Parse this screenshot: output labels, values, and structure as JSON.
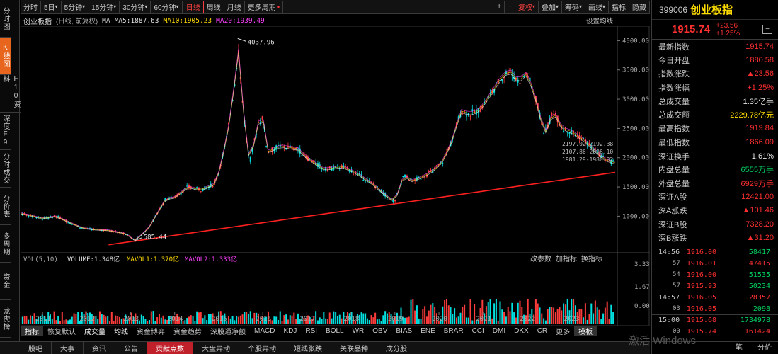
{
  "left_tabs": [
    "分时图",
    "K线图",
    "F10资料",
    "深度F9",
    "分时成交",
    "分价表",
    "多周期",
    "资金",
    "龙虎榜"
  ],
  "toolbar": {
    "items": [
      "分时",
      "5日",
      "5分钟",
      "15分钟",
      "30分钟",
      "60分钟",
      "日线",
      "周线",
      "月线",
      "更多周期"
    ],
    "active": "日线",
    "right": [
      "+",
      "−",
      "复权",
      "叠加",
      "筹码",
      "画线",
      "指标",
      "隐藏"
    ]
  },
  "chart_header": {
    "title": "创业板指",
    "period": "(日线, 前复权)",
    "ma": [
      {
        "label": "MA",
        "value": "",
        "color": "#c8c8c8"
      },
      {
        "label": "MA5:",
        "value": "1887.63",
        "color": "#e0e0e0"
      },
      {
        "label": "MA10:",
        "value": "1905.23",
        "color": "#ffdd00"
      },
      {
        "label": "MA20:",
        "value": "1939.49",
        "color": "#ff40ff"
      }
    ],
    "settings": "设置均线"
  },
  "volume_header": {
    "label": "VOL(5,10)",
    "volume": "VOLUME:1.348亿",
    "mavol1": "MAVOL1:1.370亿",
    "mavol2": "MAVOL2:1.333亿",
    "links": [
      "改参数",
      "加指标",
      "换指标"
    ]
  },
  "chart_data": {
    "type": "line",
    "price_axis": [
      4000,
      3500,
      3000,
      2500,
      2000,
      1500,
      1000
    ],
    "volume_axis": [
      "3.33",
      "1.67",
      "0.00"
    ],
    "x_years": [
      "2011",
      "2012",
      "2013",
      "2014",
      "2015",
      "2016",
      "2017",
      "2018",
      "2019",
      "2020",
      "2021",
      "2022",
      "2023"
    ],
    "annotations": {
      "high": "4037.96",
      "low": "585.44",
      "recent": [
        "2197.02-2192.38",
        "2107.86-2096.10",
        "1981.29-1980.32"
      ]
    },
    "series": [
      {
        "values": [
          [
            2010.5,
            1050
          ],
          [
            2010.8,
            1000
          ],
          [
            2011.0,
            960
          ],
          [
            2011.3,
            1000
          ],
          [
            2011.6,
            900
          ],
          [
            2011.9,
            800
          ],
          [
            2012.2,
            770
          ],
          [
            2012.5,
            760
          ],
          [
            2012.9,
            700
          ],
          [
            2013.0,
            640
          ],
          [
            2013.1,
            585
          ],
          [
            2013.4,
            790
          ],
          [
            2013.8,
            1300
          ],
          [
            2014.0,
            1320
          ],
          [
            2014.3,
            1500
          ],
          [
            2014.6,
            1450
          ],
          [
            2014.9,
            1550
          ],
          [
            2015.0,
            1750
          ],
          [
            2015.2,
            2400
          ],
          [
            2015.4,
            3500
          ],
          [
            2015.43,
            4037
          ],
          [
            2015.5,
            3300
          ],
          [
            2015.6,
            2500
          ],
          [
            2015.7,
            1900
          ],
          [
            2015.9,
            2600
          ],
          [
            2016.0,
            2700
          ],
          [
            2016.1,
            2100
          ],
          [
            2016.4,
            2200
          ],
          [
            2016.8,
            2150
          ],
          [
            2017.0,
            2000
          ],
          [
            2017.4,
            1800
          ],
          [
            2017.8,
            1850
          ],
          [
            2018.1,
            1750
          ],
          [
            2018.5,
            1550
          ],
          [
            2018.8,
            1350
          ],
          [
            2019.0,
            1250
          ],
          [
            2019.2,
            1700
          ],
          [
            2019.4,
            1600
          ],
          [
            2019.7,
            1700
          ],
          [
            2019.9,
            1800
          ],
          [
            2020.1,
            1950
          ],
          [
            2020.3,
            2300
          ],
          [
            2020.5,
            2800
          ],
          [
            2020.7,
            2750
          ],
          [
            2020.9,
            2800
          ],
          [
            2021.1,
            3000
          ],
          [
            2021.4,
            3350
          ],
          [
            2021.6,
            3500
          ],
          [
            2021.8,
            3300
          ],
          [
            2022.0,
            3450
          ],
          [
            2022.2,
            3000
          ],
          [
            2022.4,
            2400
          ],
          [
            2022.6,
            2800
          ],
          [
            2022.8,
            2500
          ],
          [
            2023.0,
            2450
          ],
          [
            2023.3,
            2300
          ],
          [
            2023.5,
            2150
          ],
          [
            2023.8,
            1950
          ],
          [
            2024.0,
            1915
          ]
        ]
      }
    ],
    "trendline": {
      "from": [
        2012.5,
        585
      ],
      "to": [
        2024.0,
        1750
      ]
    }
  },
  "indicator_tabs": [
    "指标",
    "恢复默认",
    "成交量",
    "均线",
    "资金博弈",
    "资金趋势",
    "深股通净额",
    "MACD",
    "KDJ",
    "RSI",
    "BOLL",
    "WR",
    "OBV",
    "BIAS",
    "ENE",
    "BRAR",
    "CCI",
    "DMI",
    "DKX",
    "CR",
    "更多",
    "模板"
  ],
  "bottom_nav": [
    "股吧",
    "大事",
    "资讯",
    "公告",
    "贡献点数",
    "大盘异动",
    "个股异动",
    "短线张跌",
    "关联品种",
    "成分股"
  ],
  "bottom_nav_active": "贡献点数",
  "right_panel": {
    "code": "399006",
    "name": "创业板指",
    "price": "1915.74",
    "change": "+23.56",
    "change_pct": "+1.25%",
    "mini_btn": "−",
    "rows": [
      {
        "k": "最新指数",
        "v": "1915.74",
        "c": "red"
      },
      {
        "k": "今日开盘",
        "v": "1880.58",
        "c": "red"
      },
      {
        "k": "指数涨跌",
        "v": "▲23.56",
        "c": "red"
      },
      {
        "k": "指数涨幅",
        "v": "+1.25%",
        "c": "red"
      },
      {
        "k": "总成交量",
        "v": "1.35亿手",
        "c": "wht"
      },
      {
        "k": "总成交额",
        "v": "2229.78亿元",
        "c": "yel"
      },
      {
        "k": "最高指数",
        "v": "1919.84",
        "c": "red"
      },
      {
        "k": "最低指数",
        "v": "1866.09",
        "c": "red"
      },
      {
        "k": "深证换手",
        "v": "1.61%",
        "c": "wht",
        "sep": true
      },
      {
        "k": "内盘总量",
        "v": "6555万手",
        "c": "grn"
      },
      {
        "k": "外盘总量",
        "v": "6929万手",
        "c": "red"
      },
      {
        "k": "深证A股",
        "v": "12421.00",
        "c": "red",
        "sep": true
      },
      {
        "k": "深A涨跌",
        "v": "▲101.46",
        "c": "red"
      },
      {
        "k": "深证B股",
        "v": "7328.20",
        "c": "red"
      },
      {
        "k": "深B涨跌",
        "v": "▲31.20",
        "c": "red"
      }
    ],
    "ticks": [
      {
        "t": "14:56",
        "p": "1916.00",
        "v": "58417",
        "pc": "red",
        "vc": "grn",
        "sep": true
      },
      {
        "t": "57",
        "p": "1916.01",
        "v": "47415",
        "pc": "red",
        "vc": "red",
        "s": true
      },
      {
        "t": "54",
        "p": "1916.00",
        "v": "51535",
        "pc": "red",
        "vc": "grn",
        "s": true
      },
      {
        "t": "57",
        "p": "1915.93",
        "v": "50234",
        "pc": "red",
        "vc": "grn",
        "s": true
      },
      {
        "t": "14:57",
        "p": "1916.05",
        "v": "28357",
        "pc": "red",
        "vc": "red",
        "sep": true
      },
      {
        "t": "03",
        "p": "1916.05",
        "v": "2098",
        "pc": "red",
        "vc": "grn",
        "s": true
      },
      {
        "t": "15:00",
        "p": "1915.68",
        "v": "1734978",
        "pc": "red",
        "vc": "grn",
        "sep": true
      },
      {
        "t": "00",
        "p": "1915.74",
        "v": "161424",
        "pc": "red",
        "vc": "red",
        "s": true
      }
    ],
    "bottom": [
      "笔",
      "分价"
    ]
  },
  "watermark": "激活 Windows"
}
